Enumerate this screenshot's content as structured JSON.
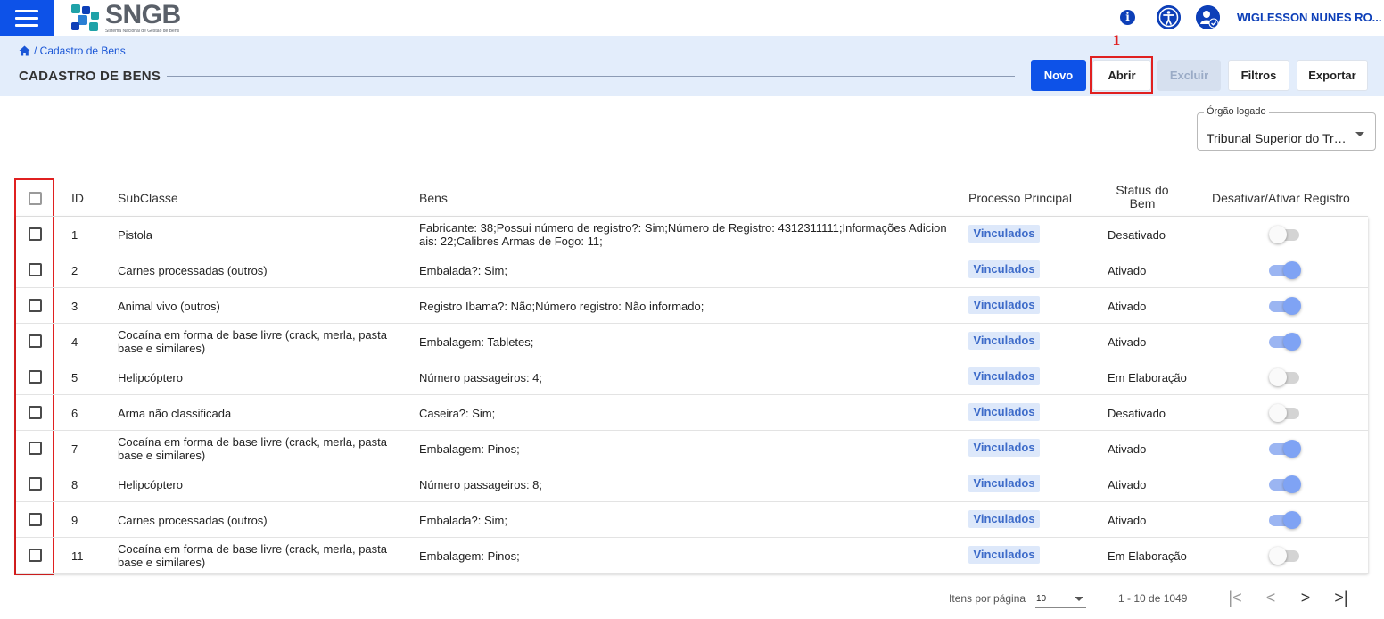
{
  "header": {
    "logo_title": "SNGB",
    "logo_subtitle": "Sistema Nacional de Gestão de Bens",
    "user_name": "WIGLESSON NUNES RO..."
  },
  "breadcrumb": "/ Cadastro de Bens",
  "page_title": "CADASTRO DE BENS",
  "toolbar": {
    "novo": "Novo",
    "abrir": "Abrir",
    "excluir": "Excluir",
    "filtros": "Filtros",
    "exportar": "Exportar"
  },
  "annotation": {
    "marker": "1"
  },
  "org_select": {
    "label": "Órgão logado",
    "value": "Tribunal Superior do Trabalho"
  },
  "table": {
    "columns": {
      "id": "ID",
      "subclasse": "SubClasse",
      "bens": "Bens",
      "processo": "Processo Principal",
      "status_line1": "Status do",
      "status_line2": "Bem",
      "toggle": "Desativar/Ativar Registro"
    },
    "rows": [
      {
        "id": "1",
        "subclasse": "Pistola",
        "bens": "Fabricante: 38;Possui número de registro?: Sim;Número de Registro: 4312311111;Informações Adicionais: 22;Calibres Armas de Fogo: 11;",
        "processo": "Vinculados",
        "status": "Desativado",
        "active": false
      },
      {
        "id": "2",
        "subclasse": "Carnes processadas (outros)",
        "bens": "Embalada?: Sim;",
        "processo": "Vinculados",
        "status": "Ativado",
        "active": true
      },
      {
        "id": "3",
        "subclasse": "Animal vivo (outros)",
        "bens": "Registro Ibama?: Não;Número registro: Não informado;",
        "processo": "Vinculados",
        "status": "Ativado",
        "active": true
      },
      {
        "id": "4",
        "subclasse": "Cocaína em forma de base livre (crack, merla, pasta base e similares)",
        "bens": "Embalagem: Tabletes;",
        "processo": "Vinculados",
        "status": "Ativado",
        "active": true
      },
      {
        "id": "5",
        "subclasse": "Helipcóptero",
        "bens": "Número passageiros: 4;",
        "processo": "Vinculados",
        "status": "Em Elaboração",
        "active": false
      },
      {
        "id": "6",
        "subclasse": "Arma não classificada",
        "bens": "Caseira?: Sim;",
        "processo": "Vinculados",
        "status": "Desativado",
        "active": false
      },
      {
        "id": "7",
        "subclasse": "Cocaína em forma de base livre (crack, merla, pasta base e similares)",
        "bens": "Embalagem: Pinos;",
        "processo": "Vinculados",
        "status": "Ativado",
        "active": true
      },
      {
        "id": "8",
        "subclasse": "Helipcóptero",
        "bens": "Número passageiros: 8;",
        "processo": "Vinculados",
        "status": "Ativado",
        "active": true
      },
      {
        "id": "9",
        "subclasse": "Carnes processadas (outros)",
        "bens": "Embalada?: Sim;",
        "processo": "Vinculados",
        "status": "Ativado",
        "active": true
      },
      {
        "id": "11",
        "subclasse": "Cocaína em forma de base livre (crack, merla, pasta base e similares)",
        "bens": "Embalagem: Pinos;",
        "processo": "Vinculados",
        "status": "Em Elaboração",
        "active": false
      }
    ]
  },
  "paginator": {
    "label": "Itens por página",
    "page_size": "10",
    "range": "1 - 10 de 1049"
  },
  "colors": {
    "primary": "#0d52e8",
    "band": "#e3edfb",
    "annotation": "#e02020",
    "toggle_on": "#7fa3f4"
  }
}
